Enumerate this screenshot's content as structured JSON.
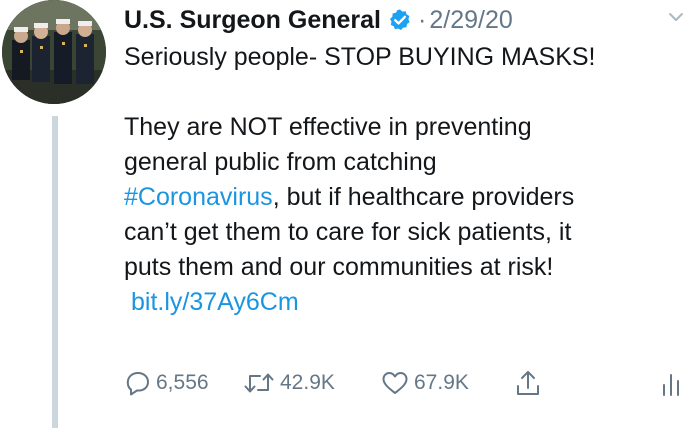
{
  "tweet": {
    "author": {
      "display_name": "U.S. Surgeon General",
      "verified": true
    },
    "separator": "·",
    "date": "2/29/20",
    "lines": [
      "Seriously people- STOP BUYING MASKS!",
      "",
      "They are NOT effective in preventing",
      "general public from catching"
    ],
    "hashtag": "#Coronavirus",
    "hashtag_tail": ", but if healthcare providers",
    "line_after_1": "can’t get them to care for sick patients, it",
    "line_after_2": "puts them and our communities at risk!",
    "short_link": "bit.ly/37Ay6Cm"
  },
  "actions": {
    "replies": "6,556",
    "retweets": "42.9K",
    "likes": "67.9K"
  },
  "icons": {
    "verified": "verified-badge-icon",
    "menu": "chevron-down-icon",
    "reply": "reply-icon",
    "retweet": "retweet-icon",
    "like": "heart-icon",
    "share": "share-icon",
    "analytics": "analytics-icon"
  },
  "colors": {
    "text": "#14171a",
    "muted": "#657786",
    "link": "#1b95e0",
    "verified": "#1da1f2",
    "thread_line": "#ccd6dd"
  }
}
